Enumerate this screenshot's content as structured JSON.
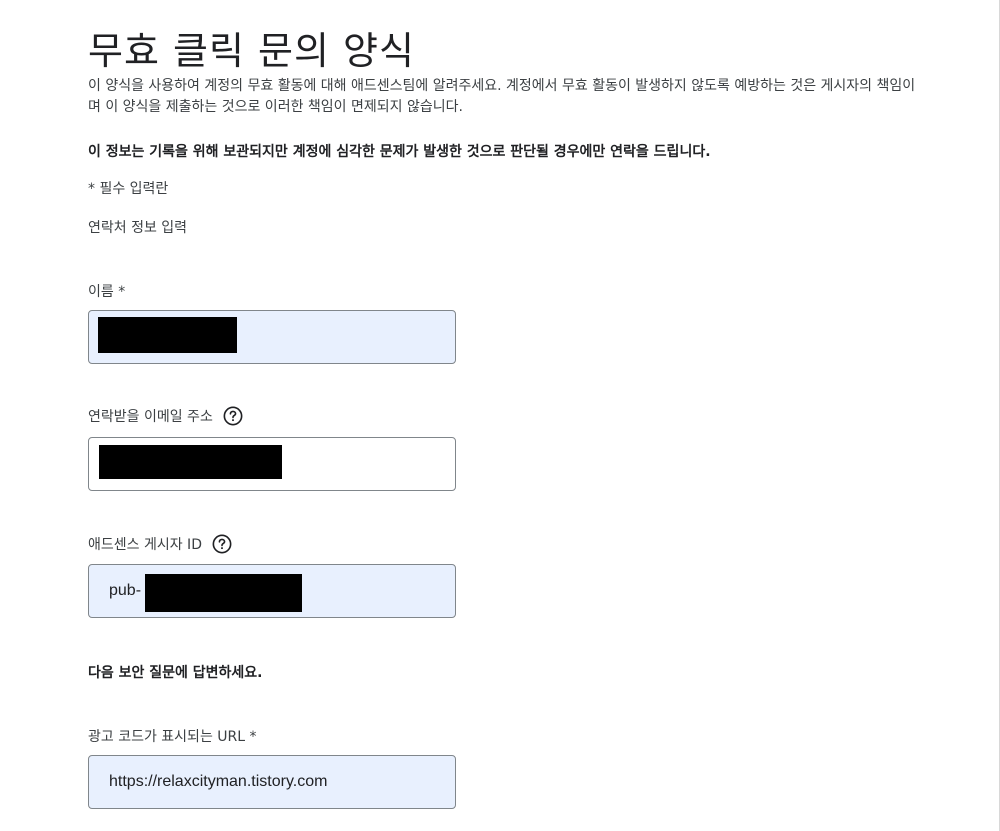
{
  "form": {
    "title": "무효 클릭 문의 양식",
    "intro": "이 양식을 사용하여 계정의 무효 활동에 대해 애드센스팀에 알려주세요. 계정에서 무효 활동이 발생하지 않도록 예방하는 것은 게시자의 책임이며 이 양식을 제출하는 것으로 이러한 책임이 면제되지 않습니다.",
    "notice": "이 정보는 기록을 위해 보관되지만 계정에 심각한 문제가 발생한 것으로 판단될 경우에만 연락을 드립니다.",
    "required_note": "* 필수 입력란",
    "contact_section": "연락처 정보 입력",
    "security_section": "다음 보안 질문에 답변하세요."
  },
  "fields": {
    "name": {
      "label": "이름 *",
      "value": ""
    },
    "email": {
      "label": "연락받을 이메일 주소",
      "value": "",
      "help_icon": "help-circle-icon"
    },
    "publisher_id": {
      "label": "애드센스 게시자 ID",
      "value": "pub-",
      "help_icon": "help-circle-icon"
    },
    "ad_url": {
      "label": "광고 코드가 표시되는 URL *",
      "value": "https://relaxcityman.tistory.com"
    }
  },
  "colors": {
    "filled_field_bg": "#e8f0fe",
    "field_border": "#80868b",
    "text": "#202124",
    "redaction": "#000000"
  }
}
